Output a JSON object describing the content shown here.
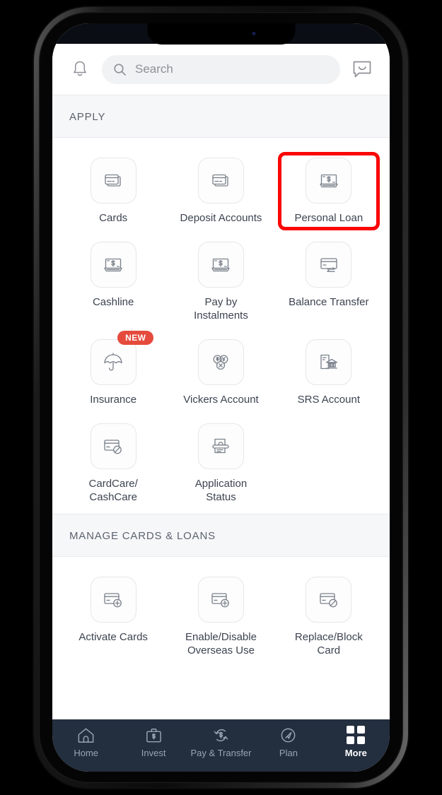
{
  "device": {
    "status_bar": {
      "time": "",
      "right": ""
    }
  },
  "header": {
    "bell_icon": "bell-icon",
    "search_placeholder": "Search",
    "chat_icon": "chat-icon"
  },
  "sections": [
    {
      "title": "APPLY",
      "tiles": [
        {
          "label": "Cards",
          "icon": "cards-icon",
          "badge": null,
          "highlighted": false
        },
        {
          "label": "Deposit Accounts",
          "icon": "deposit-accounts-icon",
          "badge": null,
          "highlighted": false
        },
        {
          "label": "Personal Loan",
          "icon": "banknote-icon",
          "badge": null,
          "highlighted": true
        },
        {
          "label": "Cashline",
          "icon": "banknote-icon",
          "badge": null,
          "highlighted": false
        },
        {
          "label": "Pay by Instalments",
          "icon": "banknote-icon",
          "badge": null,
          "highlighted": false
        },
        {
          "label": "Balance Transfer",
          "icon": "card-transfer-icon",
          "badge": null,
          "highlighted": false
        },
        {
          "label": "Insurance",
          "icon": "umbrella-icon",
          "badge": "NEW",
          "highlighted": false
        },
        {
          "label": "Vickers Account",
          "icon": "currency-circles-icon",
          "badge": null,
          "highlighted": false
        },
        {
          "label": "SRS Account",
          "icon": "bank-document-icon",
          "badge": null,
          "highlighted": false
        },
        {
          "label": "CardCare/ CashCare",
          "icon": "card-blocked-icon",
          "badge": null,
          "highlighted": false
        },
        {
          "label": "Application Status",
          "icon": "document-scan-icon",
          "badge": null,
          "highlighted": false
        }
      ]
    },
    {
      "title": "MANAGE CARDS & LOANS",
      "tiles": [
        {
          "label": "Activate Cards",
          "icon": "card-plus-icon",
          "badge": null,
          "highlighted": false
        },
        {
          "label": "Enable/Disable Overseas Use",
          "icon": "card-plus-icon",
          "badge": null,
          "highlighted": false
        },
        {
          "label": "Replace/Block Card",
          "icon": "card-blocked-icon",
          "badge": null,
          "highlighted": false
        }
      ]
    }
  ],
  "bottom_nav": {
    "items": [
      {
        "label": "Home",
        "icon": "home-icon",
        "active": false
      },
      {
        "label": "Invest",
        "icon": "briefcase-dollar-icon",
        "active": false
      },
      {
        "label": "Pay & Transfer",
        "icon": "transfer-dollar-icon",
        "active": false
      },
      {
        "label": "Plan",
        "icon": "compass-icon",
        "active": false
      },
      {
        "label": "More",
        "icon": "grid-icon",
        "active": true
      }
    ]
  },
  "colors": {
    "accent_red": "#fb0505",
    "badge_red": "#e54b3c",
    "nav_bar": "#232e3f",
    "section_bg": "#f6f7f9",
    "text_primary": "#3c4350"
  }
}
